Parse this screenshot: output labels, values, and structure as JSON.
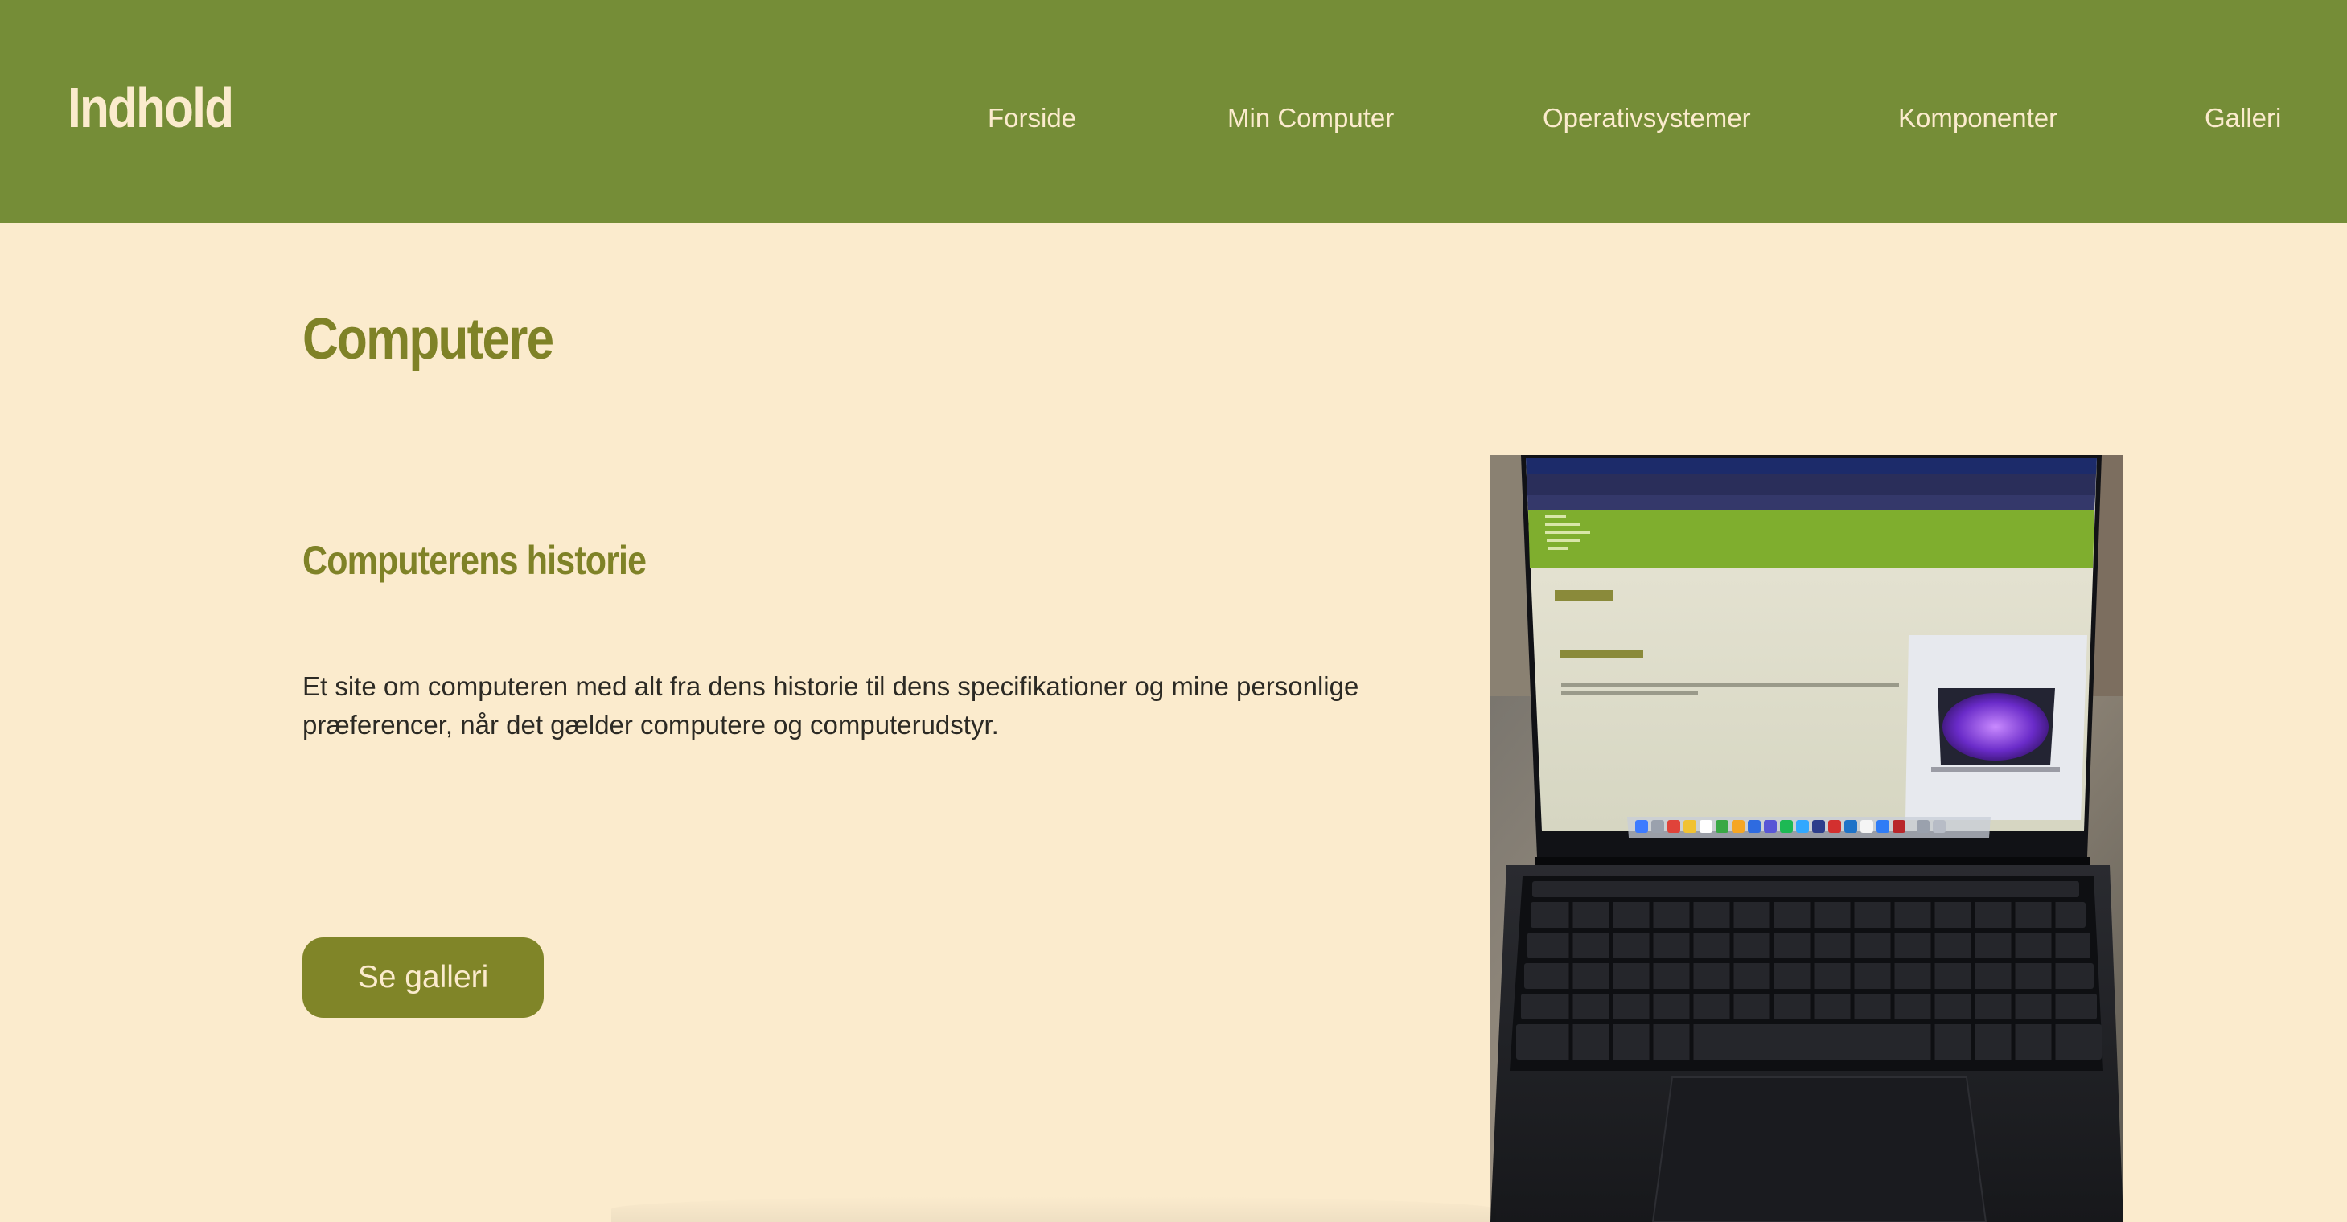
{
  "header": {
    "logo": "Indhold",
    "nav": [
      {
        "label": "Forside"
      },
      {
        "label": "Min Computer"
      },
      {
        "label": "Operativsystemer"
      },
      {
        "label": "Komponenter"
      },
      {
        "label": "Galleri"
      }
    ]
  },
  "main": {
    "title": "Computere",
    "section_heading": "Computerens historie",
    "intro": "Et site om computeren med alt fra dens historie til dens specifikationer og mine personlige præferencer, når det gælder computere og computerudstyr.",
    "button_label": "Se galleri"
  },
  "colors": {
    "header_bg": "#758d37",
    "page_bg": "#fbebcd",
    "heading": "#7f8227",
    "button_bg": "#808528",
    "text": "#2c2a24"
  }
}
